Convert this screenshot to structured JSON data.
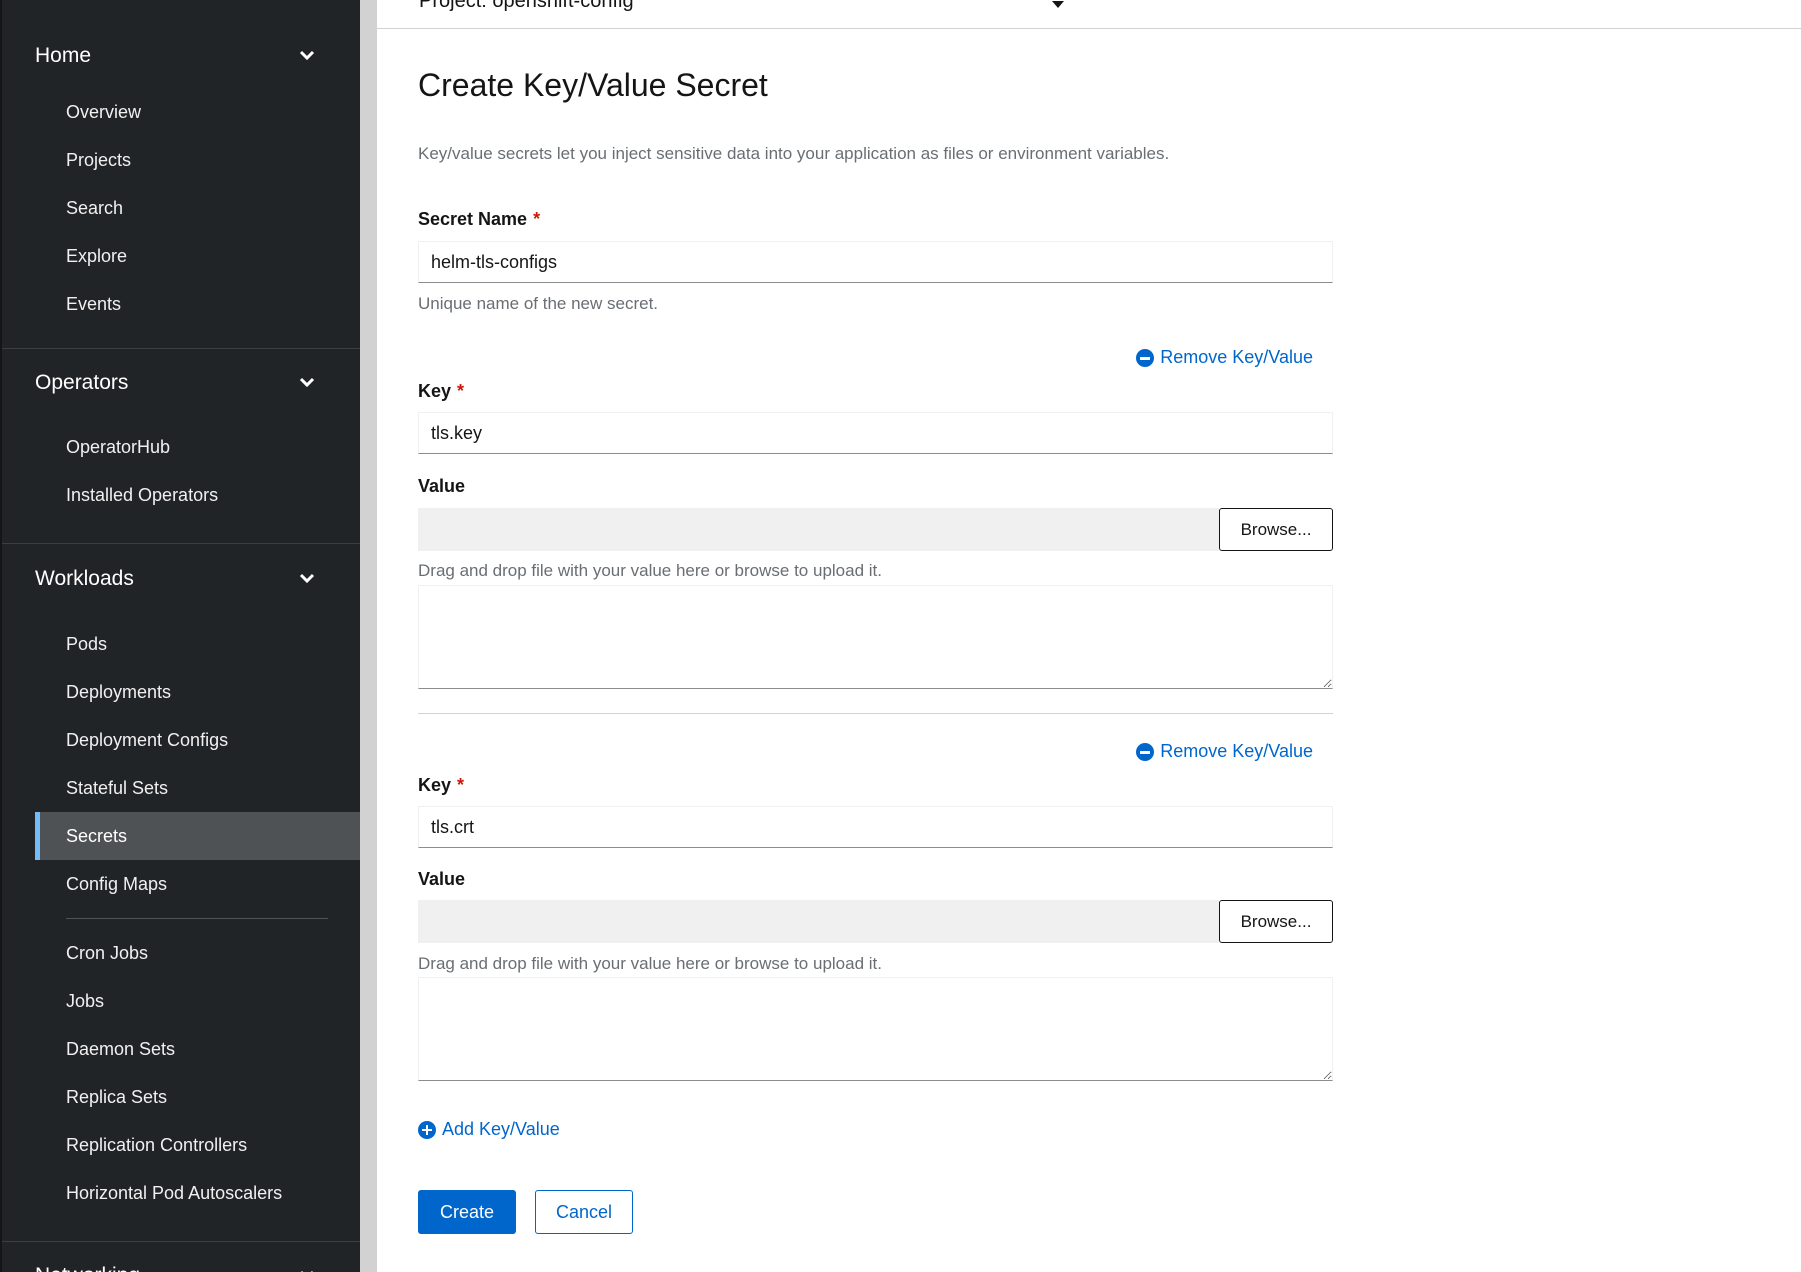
{
  "project": {
    "label": "Project: openshift-config"
  },
  "sidebar": {
    "sections": [
      {
        "title": "Home",
        "items": [
          "Overview",
          "Projects",
          "Search",
          "Explore",
          "Events"
        ]
      },
      {
        "title": "Operators",
        "items": [
          "OperatorHub",
          "Installed Operators"
        ]
      },
      {
        "title": "Workloads",
        "items": [
          "Pods",
          "Deployments",
          "Deployment Configs",
          "Stateful Sets",
          "Secrets",
          "Config Maps",
          "Cron Jobs",
          "Jobs",
          "Daemon Sets",
          "Replica Sets",
          "Replication Controllers",
          "Horizontal Pod Autoscalers"
        ]
      },
      {
        "title": "Networking"
      }
    ],
    "active_item": "Secrets"
  },
  "form": {
    "title": "Create Key/Value Secret",
    "description": "Key/value secrets let you inject sensitive data into your application as files or environment variables.",
    "secret_name_label": "Secret Name",
    "required_mark": "*",
    "secret_name_value": "helm-tls-configs",
    "secret_name_helper": "Unique name of the new secret.",
    "pairs": [
      {
        "remove_label": "Remove Key/Value",
        "key_label": "Key",
        "key_value": "tls.key",
        "value_label": "Value",
        "browse_label": "Browse...",
        "drag_helper": "Drag and drop file with your value here or browse to upload it."
      },
      {
        "remove_label": "Remove Key/Value",
        "key_label": "Key",
        "key_value": "tls.crt",
        "value_label": "Value",
        "browse_label": "Browse...",
        "drag_helper": "Drag and drop file with your value here or browse to upload it."
      }
    ],
    "add_label": "Add Key/Value",
    "create_label": "Create",
    "cancel_label": "Cancel"
  },
  "colors": {
    "sidebar_bg": "#212427",
    "accent_blue": "#0066cc",
    "active_marker": "#73bcf7",
    "required_red": "#c9190b"
  }
}
